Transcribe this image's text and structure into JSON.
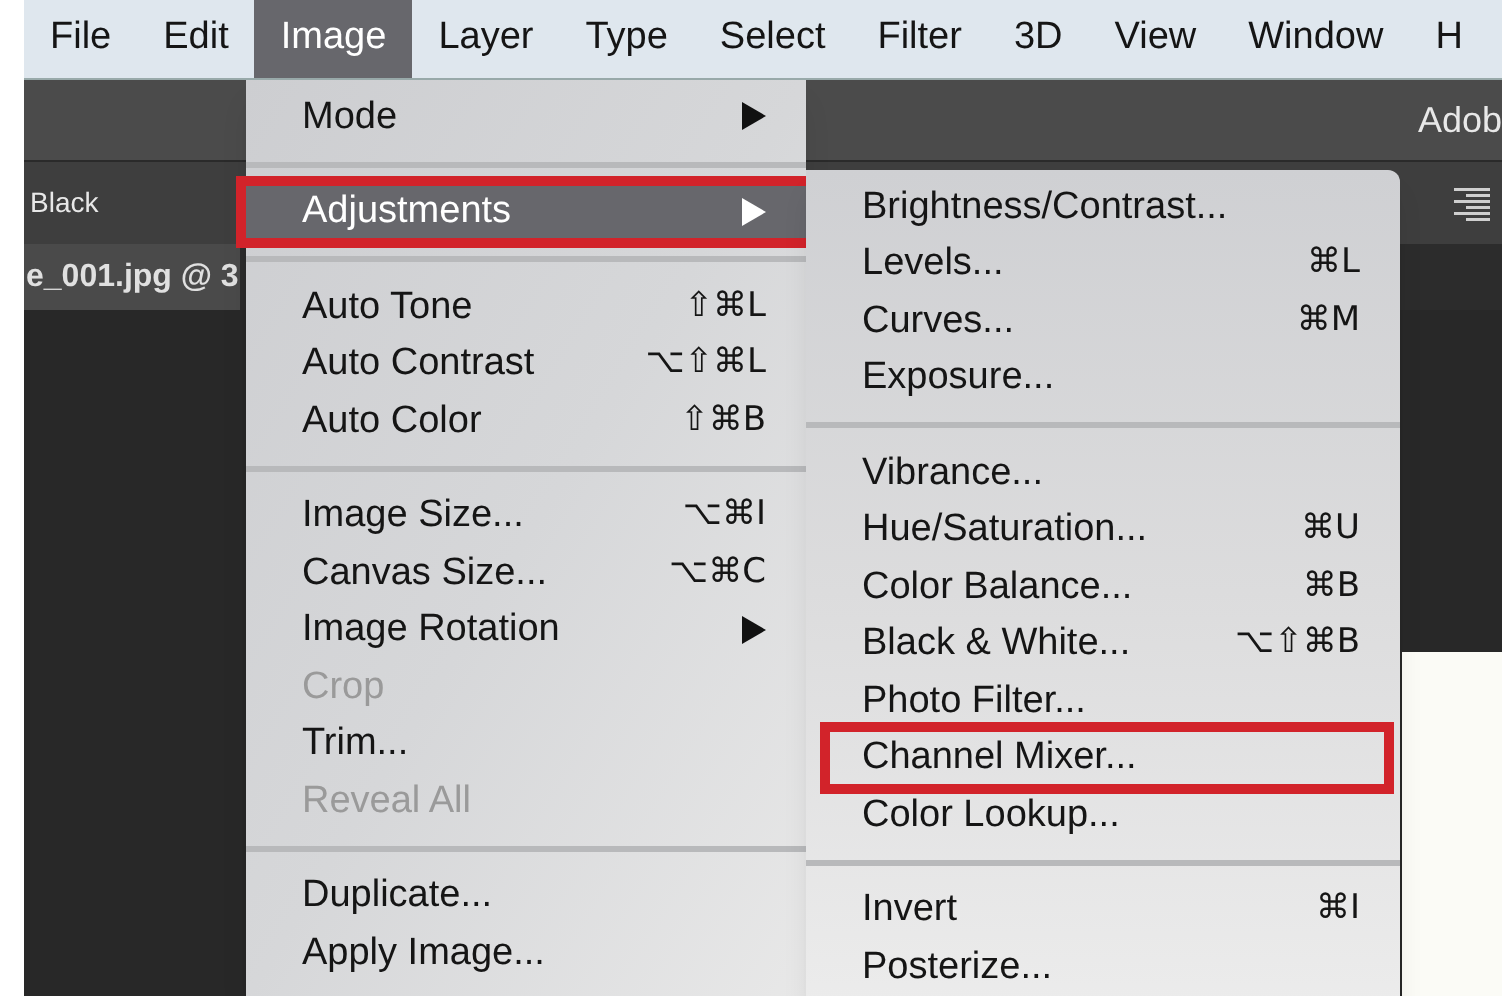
{
  "menu_bar": [
    {
      "label": "File",
      "selected": false
    },
    {
      "label": "Edit",
      "selected": false
    },
    {
      "label": "Image",
      "selected": true
    },
    {
      "label": "Layer",
      "selected": false
    },
    {
      "label": "Type",
      "selected": false
    },
    {
      "label": "Select",
      "selected": false
    },
    {
      "label": "Filter",
      "selected": false
    },
    {
      "label": "3D",
      "selected": false
    },
    {
      "label": "View",
      "selected": false
    },
    {
      "label": "Window",
      "selected": false
    },
    {
      "label": "H",
      "selected": false
    }
  ],
  "app_title": "Adob",
  "options_bar": {
    "label": "Black"
  },
  "document_tab": {
    "label": "e_001.jpg @ 3"
  },
  "image_menu": {
    "groups": [
      [
        {
          "label": "Mode",
          "submenu": true,
          "disabled": false,
          "selected": false,
          "outlined": false
        }
      ],
      [
        {
          "label": "Adjustments",
          "submenu": true,
          "disabled": false,
          "selected": true,
          "outlined": true
        }
      ],
      [
        {
          "label": "Auto Tone",
          "shortcut": "⇧⌘L",
          "submenu": false,
          "disabled": false,
          "selected": false,
          "outlined": false
        },
        {
          "label": "Auto Contrast",
          "shortcut": "⌥⇧⌘L",
          "submenu": false,
          "disabled": false,
          "selected": false,
          "outlined": false
        },
        {
          "label": "Auto Color",
          "shortcut": "⇧⌘B",
          "submenu": false,
          "disabled": false,
          "selected": false,
          "outlined": false
        }
      ],
      [
        {
          "label": "Image Size...",
          "shortcut": "⌥⌘I",
          "submenu": false,
          "disabled": false,
          "selected": false,
          "outlined": false
        },
        {
          "label": "Canvas Size...",
          "shortcut": "⌥⌘C",
          "submenu": false,
          "disabled": false,
          "selected": false,
          "outlined": false
        },
        {
          "label": "Image Rotation",
          "submenu": true,
          "disabled": false,
          "selected": false,
          "outlined": false
        },
        {
          "label": "Crop",
          "submenu": false,
          "disabled": true,
          "selected": false,
          "outlined": false
        },
        {
          "label": "Trim...",
          "submenu": false,
          "disabled": false,
          "selected": false,
          "outlined": false
        },
        {
          "label": "Reveal All",
          "submenu": false,
          "disabled": true,
          "selected": false,
          "outlined": false
        }
      ],
      [
        {
          "label": "Duplicate...",
          "submenu": false,
          "disabled": false,
          "selected": false,
          "outlined": false
        },
        {
          "label": "Apply Image...",
          "submenu": false,
          "disabled": false,
          "selected": false,
          "outlined": false
        }
      ]
    ]
  },
  "adjustments_menu": {
    "groups": [
      [
        {
          "label": "Brightness/Contrast...",
          "submenu": false,
          "disabled": false,
          "selected": false,
          "outlined": false
        },
        {
          "label": "Levels...",
          "shortcut": "⌘L",
          "submenu": false,
          "disabled": false,
          "selected": false,
          "outlined": false
        },
        {
          "label": "Curves...",
          "shortcut": "⌘M",
          "submenu": false,
          "disabled": false,
          "selected": false,
          "outlined": false
        },
        {
          "label": "Exposure...",
          "submenu": false,
          "disabled": false,
          "selected": false,
          "outlined": false
        }
      ],
      [
        {
          "label": "Vibrance...",
          "submenu": false,
          "disabled": false,
          "selected": false,
          "outlined": false
        },
        {
          "label": "Hue/Saturation...",
          "shortcut": "⌘U",
          "submenu": false,
          "disabled": false,
          "selected": false,
          "outlined": false
        },
        {
          "label": "Color Balance...",
          "shortcut": "⌘B",
          "submenu": false,
          "disabled": false,
          "selected": false,
          "outlined": false
        },
        {
          "label": "Black & White...",
          "shortcut": "⌥⇧⌘B",
          "submenu": false,
          "disabled": false,
          "selected": false,
          "outlined": false
        },
        {
          "label": "Photo Filter...",
          "submenu": false,
          "disabled": false,
          "selected": false,
          "outlined": false
        },
        {
          "label": "Channel Mixer...",
          "submenu": false,
          "disabled": false,
          "selected": false,
          "outlined": true
        },
        {
          "label": "Color Lookup...",
          "submenu": false,
          "disabled": false,
          "selected": false,
          "outlined": false
        }
      ],
      [
        {
          "label": "Invert",
          "shortcut": "⌘I",
          "submenu": false,
          "disabled": false,
          "selected": false,
          "outlined": false
        },
        {
          "label": "Posterize...",
          "submenu": false,
          "disabled": false,
          "selected": false,
          "outlined": false
        }
      ]
    ]
  }
}
